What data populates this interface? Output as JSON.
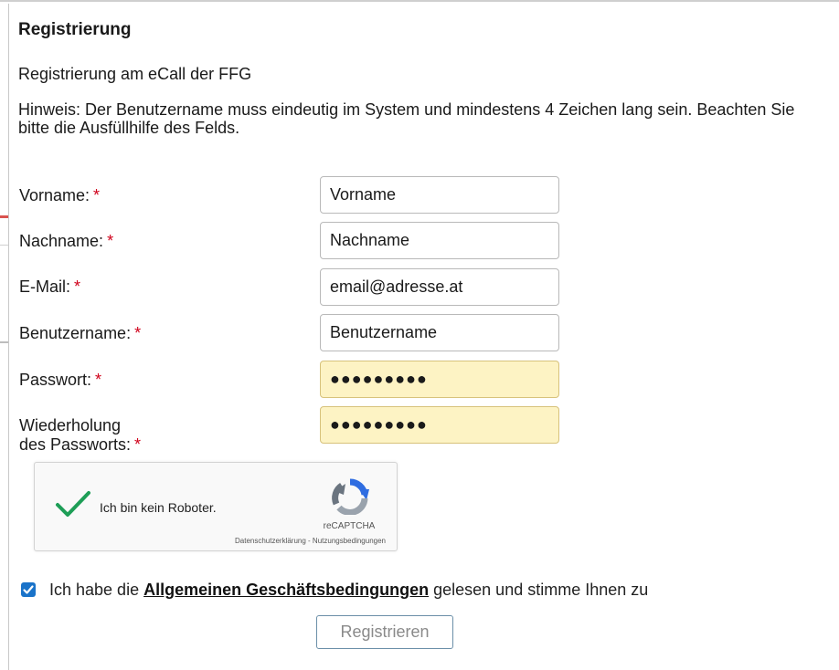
{
  "dialog": {
    "title": "Registrierung",
    "subtitle": "Registrierung am eCall der FFG",
    "hint": "Hinweis: Der Benutzername muss eindeutig im System und mindestens 4 Zeichen lang sein. Beachten Sie bitte die Ausfüllhilfe des Felds."
  },
  "form": {
    "required_marker": "*",
    "fields": [
      {
        "label": "Vorname:",
        "value": "Vorname"
      },
      {
        "label": "Nachname:",
        "value": "Nachname"
      },
      {
        "label": "E-Mail:",
        "value": "email@adresse.at"
      },
      {
        "label": "Benutzername:",
        "value": "Benutzername"
      },
      {
        "label": "Passwort:",
        "value": "●●●●●●●●●"
      },
      {
        "label_line1": "Wiederholung",
        "label_line2": "des Passworts:",
        "value": "●●●●●●●●●"
      }
    ]
  },
  "captcha": {
    "label": "Ich bin kein Roboter.",
    "brand": "reCAPTCHA",
    "links": "Datenschutzerklärung - Nutzungsbedingungen",
    "checked": true,
    "check_color": "#1e9e57"
  },
  "agb": {
    "checked": true,
    "text_before": "Ich habe die ",
    "link_text": "Allgemeinen Geschäftsbedingungen",
    "text_after": " gelesen und stimme Ihnen zu"
  },
  "submit": {
    "label": "Registrieren"
  },
  "colors": {
    "required": "#d0021b",
    "password_bg": "#fdf3c4",
    "checkbox": "#1a73c9"
  }
}
